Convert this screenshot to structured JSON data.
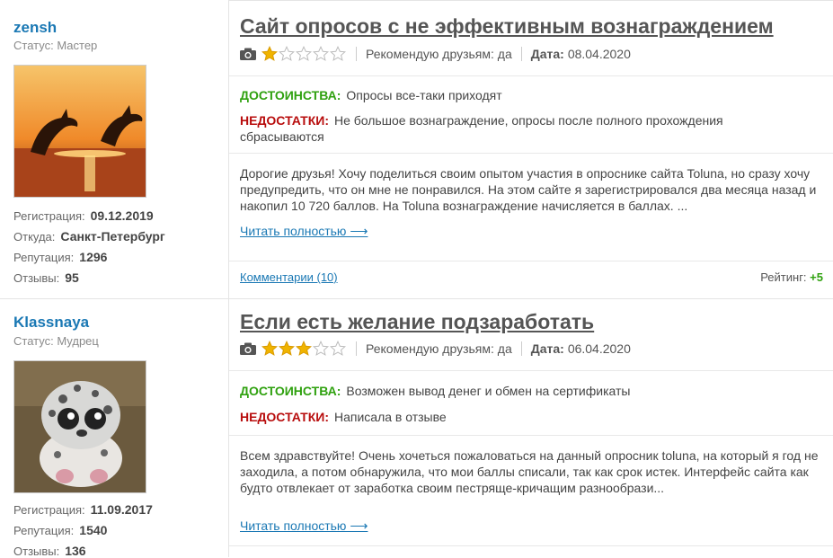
{
  "reviews": [
    {
      "user": {
        "name": "zensh",
        "status": "Статус: Мастер",
        "reg_label": "Регистрация:",
        "reg_value": "09.12.2019",
        "from_label": "Откуда:",
        "from_value": "Санкт-Петербург",
        "rep_label": "Репутация:",
        "rep_value": "1296",
        "reviews_label": "Отзывы:",
        "reviews_value": "95"
      },
      "title": "Сайт опросов с не эффективным вознаграждением",
      "stars": 1,
      "recommend": "Рекомендую друзьям: да",
      "date_label": "Дата:",
      "date_value": "08.04.2020",
      "pros_label": "ДОСТОИНСТВА:",
      "pros": "Опросы все-таки приходят",
      "cons_label": "НЕДОСТАТКИ:",
      "cons": "Не большое вознаграждение, опросы после полного прохождения сбрасываются",
      "text": "Дорогие друзья! Хочу поделиться своим опытом участия в опроснике сайта Toluna, но сразу хочу предупредить, что он мне не понравился. На этом сайте я зарегистрировался два месяца назад и накопил 10 720 баллов. На Toluna вознаграждение начисляется в баллах. ...",
      "read_more": "Читать полностью ⟶",
      "comments": "Комментарии (10)",
      "rating_label": "Рейтинг:",
      "rating_value": "+5"
    },
    {
      "user": {
        "name": "Klassnaya",
        "status": "Статус: Мудрец",
        "reg_label": "Регистрация:",
        "reg_value": "11.09.2017",
        "rep_label": "Репутация:",
        "rep_value": "1540",
        "reviews_label": "Отзывы:",
        "reviews_value": "136"
      },
      "title": "Если есть желание подзаработать",
      "stars": 3,
      "recommend": "Рекомендую друзьям: да",
      "date_label": "Дата:",
      "date_value": "06.04.2020",
      "pros_label": "ДОСТОИНСТВА:",
      "pros": "Возможен вывод денег и обмен на сертификаты",
      "cons_label": "НЕДОСТАТКИ:",
      "cons": "Написала в отзыве",
      "text": "Всем здравствуйте! Очень хочеться пожаловаться на данный опросник toluna, на который я год не заходила, а потом обнаружила, что мои баллы списали, так как срок истек. Интерфейс сайта как будто отвлекает от заработка своим пестряще-кричащим разнообрази...",
      "read_more": "Читать полностью ⟶"
    }
  ],
  "colors": {
    "link": "#1a78b4",
    "pros": "#2fa10f",
    "cons": "#b80d0d",
    "star": "#f0b400"
  },
  "icons": {
    "camera": "camera-icon",
    "star_full": "star-filled-icon",
    "star_empty": "star-empty-icon"
  }
}
